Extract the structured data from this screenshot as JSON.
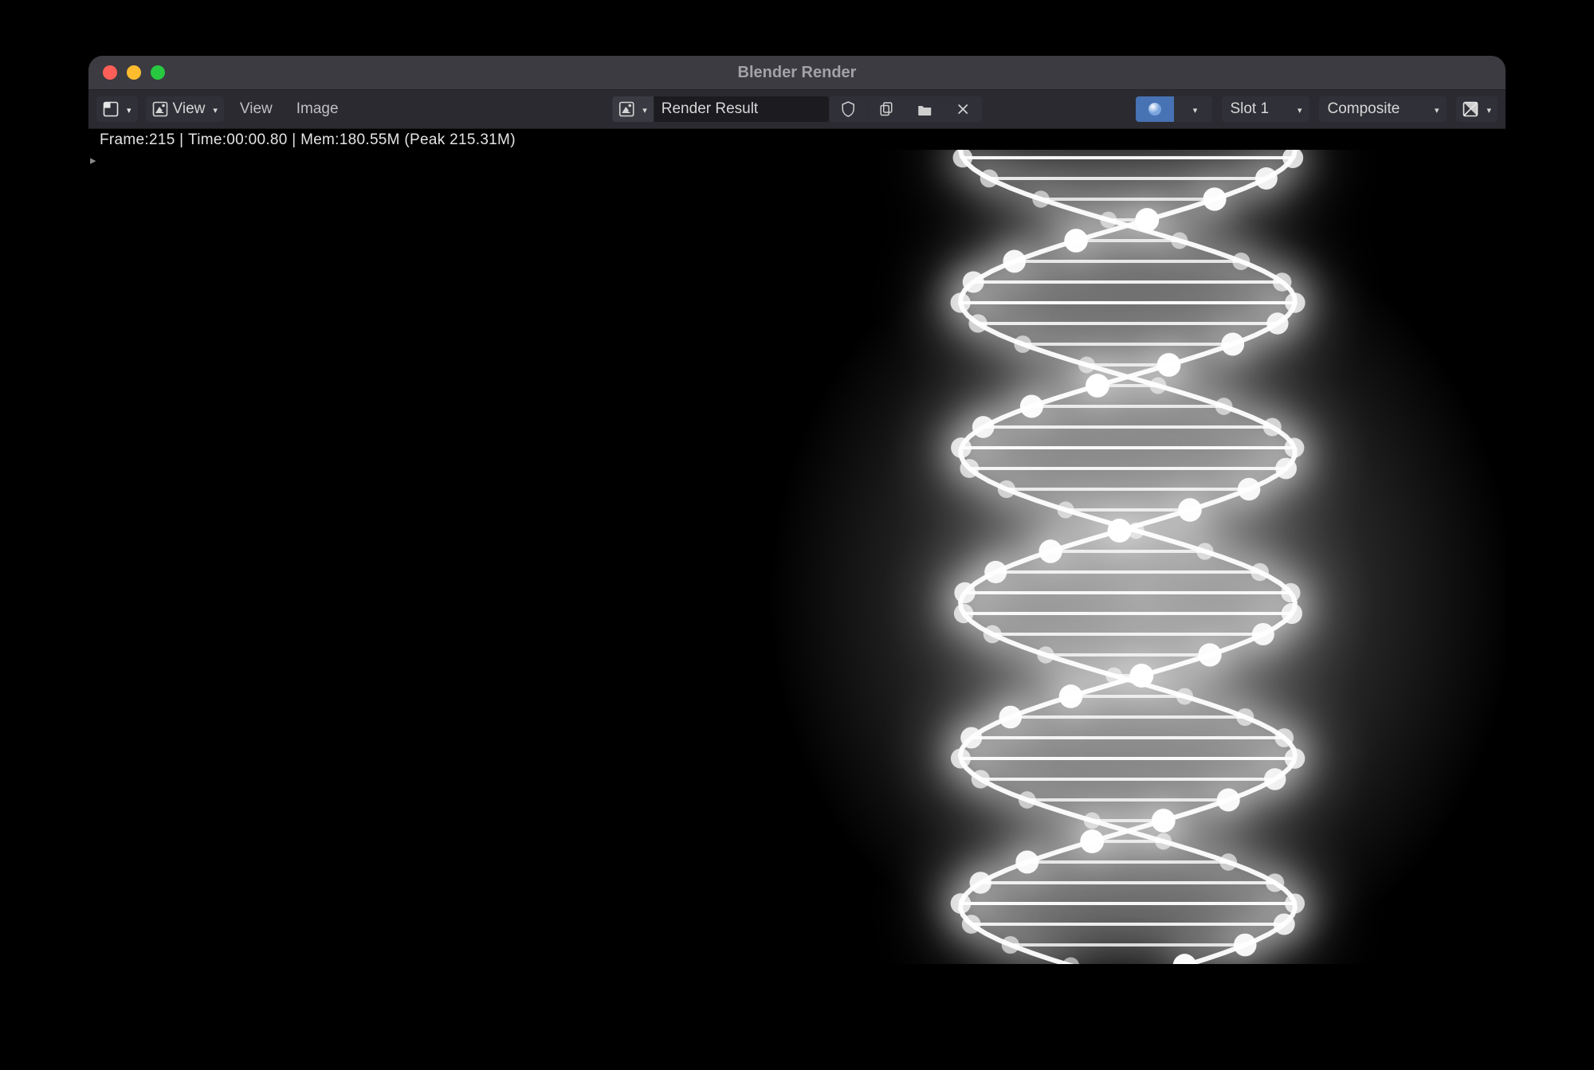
{
  "window": {
    "title": "Blender Render"
  },
  "toolbar": {
    "view_btn": "View",
    "view_menu": "View",
    "image_menu": "Image",
    "render_result": "Render Result",
    "slot": "Slot 1",
    "layer": "Composite"
  },
  "status": {
    "frame_label": "Frame:",
    "frame": "215",
    "time_label": "Time:",
    "time": "00:00.80",
    "mem_label": "Mem:",
    "mem": "180.55M",
    "peak_label": "Peak",
    "peak": "215.31M"
  },
  "icons": {
    "editor_type": "editor-type-icon",
    "mode": "image-mode-icon",
    "image_browse": "image-browse-icon",
    "shield": "shield-icon",
    "copy": "copy-icon",
    "open": "folder-open-icon",
    "close": "close-icon",
    "shading": "viewport-shading-icon",
    "display_channels": "display-channels-icon",
    "zoom": "zoom-icon",
    "pan": "pan-icon"
  },
  "render": {
    "subject": "glowing DNA double helix",
    "background": "#000000",
    "glow_color": "#ffffff"
  }
}
